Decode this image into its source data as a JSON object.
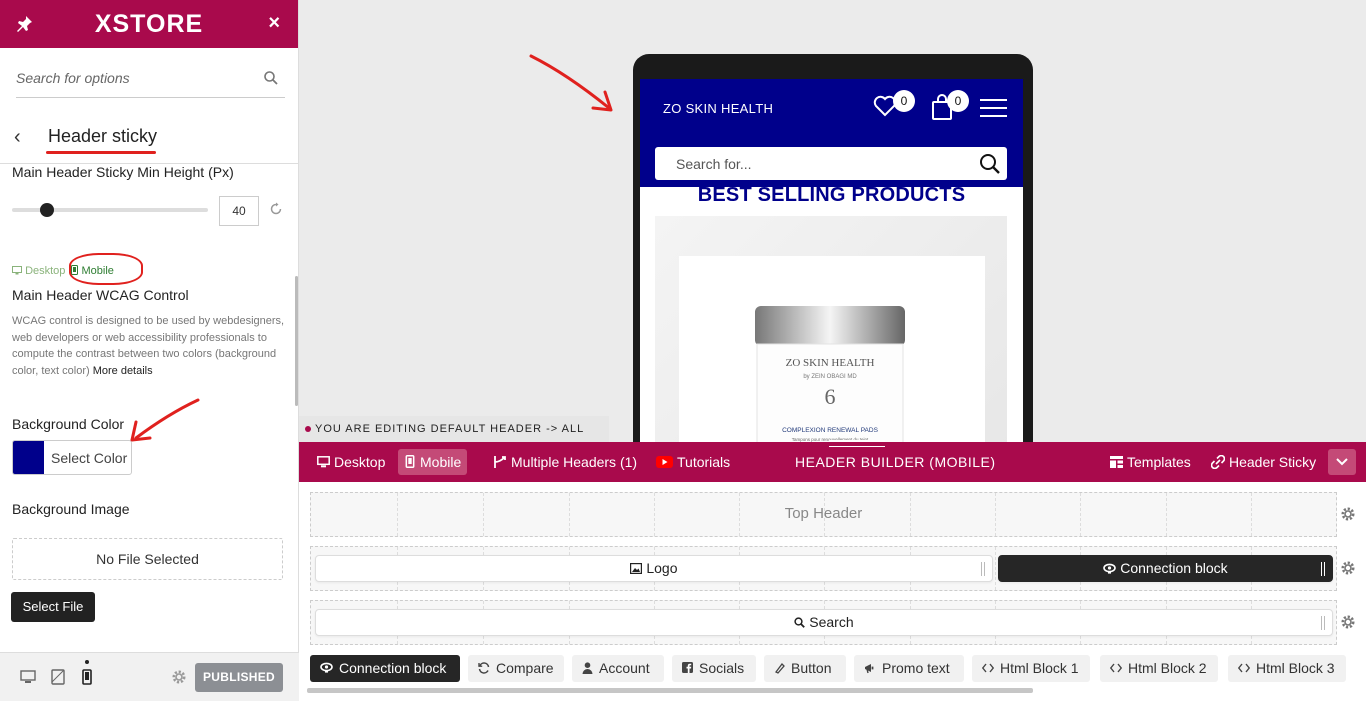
{
  "sidebar": {
    "brand": "XSTORE",
    "close": "×",
    "search": {
      "placeholder": "Search for options",
      "value": ""
    },
    "section_title": "Header sticky",
    "fields": {
      "min_height_label": "Main Header Sticky Min Height (Px)",
      "min_height_value": "40",
      "min_height_fraction": 0.18,
      "device_desktop": "Desktop",
      "device_mobile": "Mobile",
      "wcag_label": "Main Header WCAG Control",
      "wcag_desc": "WCAG control is designed to be used by webdesigners, web developers or web accessibility professionals to compute the contrast between two colors (background color, text color)",
      "wcag_more": "More details",
      "bg_color_label": "Background Color",
      "bg_color_button": "Select Color",
      "bg_color_value": "#00008b",
      "bg_image_label": "Background Image",
      "no_file": "No File Selected",
      "select_file": "Select File"
    },
    "footer": {
      "published": "PUBLISHED"
    }
  },
  "preview": {
    "phone": {
      "brand": "ZO SKIN HEALTH",
      "wishlist_count": "0",
      "cart_count": "0",
      "search_placeholder": "Search for...",
      "section_heading": "BEST SELLING PRODUCTS",
      "product": {
        "brand_line": "ZO SKIN HEALTH",
        "sub_line": "by ZEIN OBAGI MD",
        "name": "COMPLEXION RENEWAL PADS",
        "tagline": "Tampons pour renouvellement du teint"
      }
    },
    "editing_notice": "YOU ARE EDITING DEFAULT HEADER -> ALL SITE"
  },
  "builder": {
    "toolbar": {
      "desktop": "Desktop",
      "mobile": "Mobile",
      "multiple_headers": "Multiple Headers (1)",
      "tutorials": "Tutorials",
      "title": "HEADER BUILDER (MOBILE)",
      "templates": "Templates",
      "header_sticky": "Header Sticky"
    },
    "rows": {
      "top": "Top Header",
      "logo": "Logo",
      "connection_block": "Connection block",
      "search": "Search"
    },
    "available": [
      "Connection block",
      "Compare",
      "Account",
      "Socials",
      "Button",
      "Promo text",
      "Html Block 1",
      "Html Block 2",
      "Html Block 3"
    ]
  },
  "colors": {
    "accent": "#a90a4c",
    "preview_header": "#00008b",
    "annotation_red": "#e0211e"
  }
}
